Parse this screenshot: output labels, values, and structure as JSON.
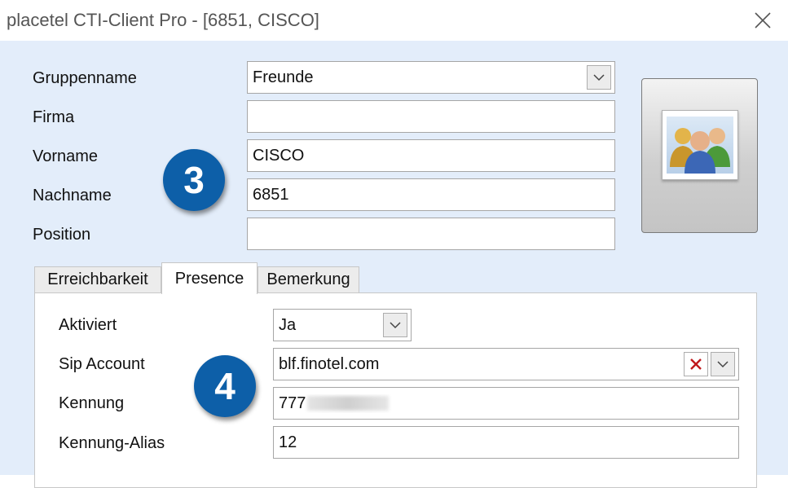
{
  "window": {
    "title": "placetel CTI-Client Pro - [6851, CISCO]"
  },
  "form": {
    "gruppenname_label": "Gruppenname",
    "gruppenname_value": "Freunde",
    "firma_label": "Firma",
    "firma_value": "",
    "vorname_label": "Vorname",
    "vorname_value": "CISCO",
    "nachname_label": "Nachname",
    "nachname_value": "6851",
    "position_label": "Position",
    "position_value": ""
  },
  "contact_image": {
    "icon": "user-group-icon"
  },
  "badges": {
    "step3": "3",
    "step4": "4"
  },
  "tabs": [
    {
      "label": "Erreichbarkeit",
      "active": false
    },
    {
      "label": "Presence",
      "active": true
    },
    {
      "label": "Bemerkung",
      "active": false
    }
  ],
  "presence": {
    "aktiviert_label": "Aktiviert",
    "aktiviert_value": "Ja",
    "sip_label": "Sip Account",
    "sip_value": "blf.finotel.com",
    "kennung_label": "Kennung",
    "kennung_value": "777",
    "alias_label": "Kennung-Alias",
    "alias_value": "12"
  },
  "colors": {
    "badge": "#0d5fa8",
    "content_bg": "#e3edfa",
    "clear_x": "#c0181c"
  }
}
